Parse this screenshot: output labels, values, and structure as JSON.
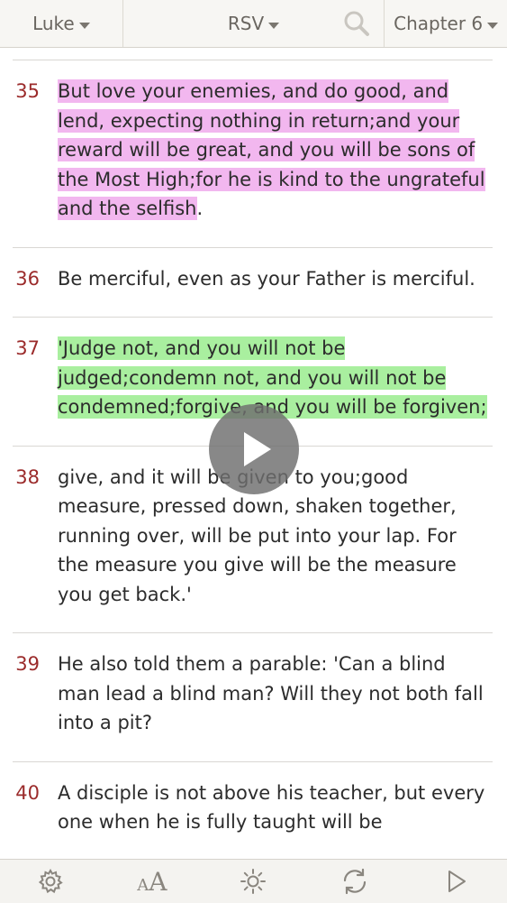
{
  "topbar": {
    "book": "Luke",
    "version": "RSV",
    "chapter": "Chapter 6",
    "search_icon": "search-icon"
  },
  "verses": [
    {
      "num": "35",
      "text": "But love your enemies, and do good, and lend, expecting nothing in return;and your reward will be great, and you will be sons of the Most High;for he is kind to the ungrateful and the selfish",
      "tail": ".",
      "highlight": "pink"
    },
    {
      "num": "36",
      "text": "Be merciful, even as your Father is merciful.",
      "tail": "",
      "highlight": "none"
    },
    {
      "num": "37",
      "text": "'Judge not, and you will not be judged;condemn not, and you will not be condemned;forgive, and you will be forgiven;",
      "tail": "",
      "highlight": "green"
    },
    {
      "num": "38",
      "text": "give, and it will be given to you;good measure, pressed down, shaken together, running over, will be put into your lap. For the measure you give will be the measure you get back.'",
      "tail": "",
      "highlight": "none"
    },
    {
      "num": "39",
      "text": "He also told them a parable: 'Can a blind man lead a blind man? Will they not both fall into a pit?",
      "tail": "",
      "highlight": "none"
    },
    {
      "num": "40",
      "text": "A disciple is not above his teacher, but every one when he is fully taught will be",
      "tail": "",
      "highlight": "none"
    }
  ],
  "highlight_colors": {
    "pink": "#f2b7ef",
    "green": "#a9ef9f"
  },
  "verse_number_color": "#9b2b2b",
  "bottombar": {
    "font_small": "A",
    "font_large": "A",
    "icons": [
      "gear-icon",
      "font-size-icon",
      "brightness-icon",
      "sync-icon",
      "play-icon"
    ]
  },
  "overlay": {
    "icon": "play-icon"
  }
}
